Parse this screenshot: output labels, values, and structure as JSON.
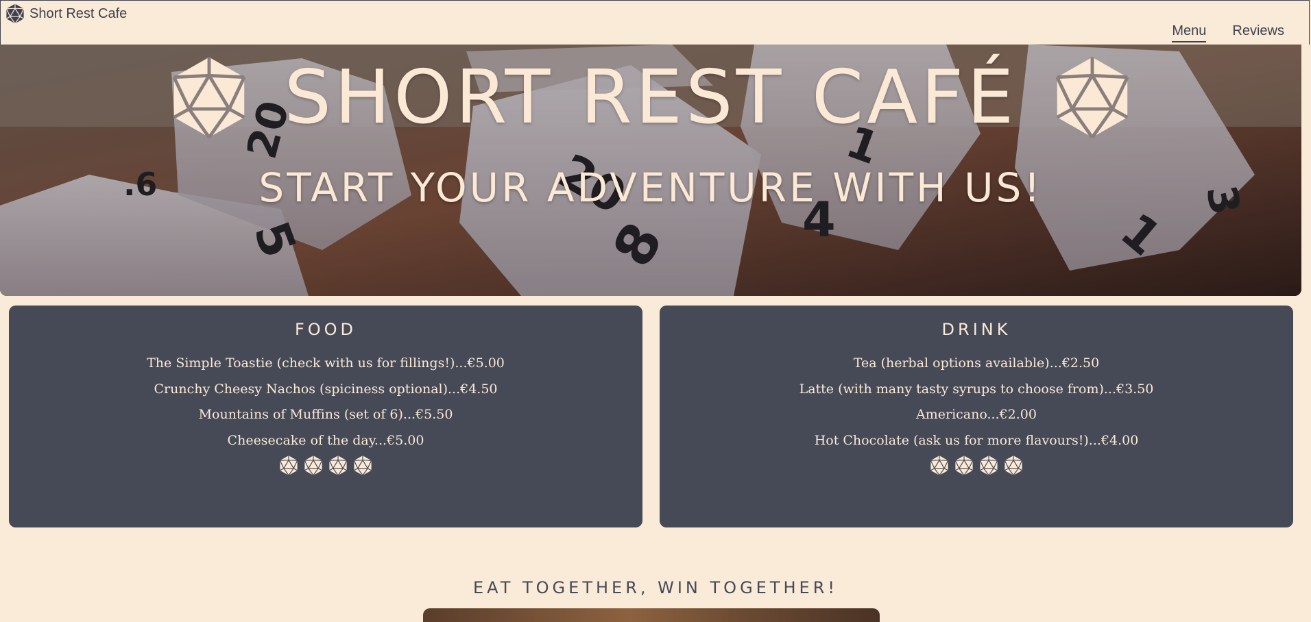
{
  "nav": {
    "brand": "Short Rest Cafe",
    "links": [
      "Menu",
      "Reviews"
    ]
  },
  "hero": {
    "title": "SHORT REST CAFÉ",
    "subtitle": "START YOUR ADVENTURE WITH US!"
  },
  "menu": {
    "food": {
      "heading": "FOOD",
      "items": [
        "The Simple Toastie (check with us for fillings!)...€5.00",
        "Crunchy Cheesy Nachos (spiciness optional)...€4.50",
        "Mountains of Muffins (set of 6)...€5.50",
        "Cheesecake of the day...€5.00"
      ],
      "rating": 4
    },
    "drink": {
      "heading": "DRINK",
      "items": [
        "Tea (herbal options available)...€2.50",
        "Latte (with many tasty syrups to choose from)...€3.50",
        "Americano...€2.00",
        "Hot Chocolate (ask us for more flavours!)...€4.00"
      ],
      "rating": 4
    }
  },
  "tagline": "EAT TOGETHER, WIN TOGETHER!",
  "icons": {
    "logo": "d20-dice-icon",
    "rating": "d20-dice-icon"
  },
  "colors": {
    "background": "#faead8",
    "card": "#464a57",
    "cream": "#fbe9d6",
    "text": "#3e4250"
  }
}
